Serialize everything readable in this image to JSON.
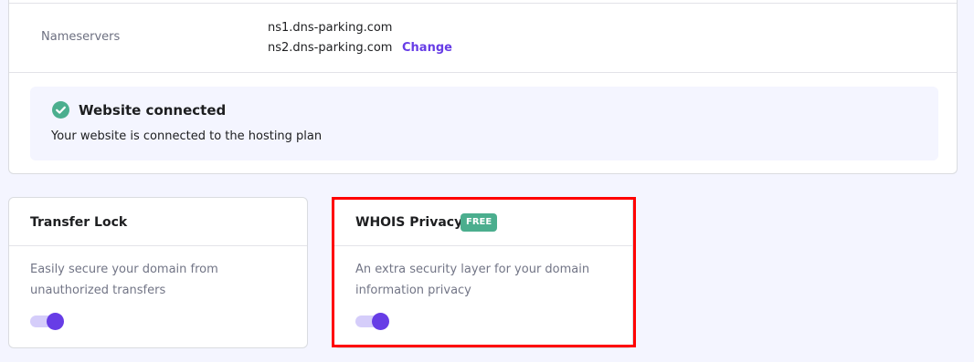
{
  "nameservers": {
    "label": "Nameservers",
    "values": [
      "ns1.dns-parking.com",
      "ns2.dns-parking.com"
    ],
    "change_label": "Change"
  },
  "website_status": {
    "icon": "check-circle-icon",
    "title": "Website connected",
    "description": "Your website is connected to the hosting plan"
  },
  "cards": {
    "transfer_lock": {
      "title": "Transfer Lock",
      "description": "Easily secure your domain from unauthorized transfers",
      "enabled": true
    },
    "whois_privacy": {
      "title": "WHOIS Privacy",
      "badge": "FREE",
      "description": "An extra security layer for your domain information privacy",
      "enabled": true
    }
  },
  "colors": {
    "accent": "#673de6",
    "success": "#4bae8e",
    "highlight": "#ff0000"
  }
}
